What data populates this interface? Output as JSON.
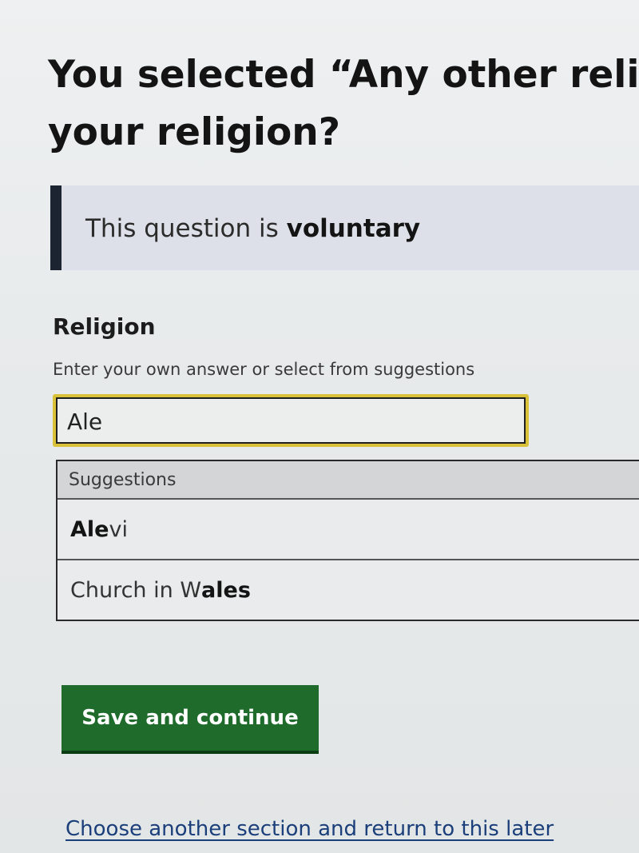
{
  "heading": {
    "line1": "You selected “Any other relig",
    "line2": "your religion?"
  },
  "notice": {
    "prefix": "This question is ",
    "emphasis": "voluntary"
  },
  "field": {
    "label": "Religion",
    "hint": "Enter your own answer or select from suggestions",
    "value": "Ale"
  },
  "suggestions": {
    "header": "Suggestions",
    "items": [
      {
        "match": "Ale",
        "rest": "vi",
        "pre": ""
      },
      {
        "pre": "Church in W",
        "match": "ales",
        "rest": ""
      }
    ]
  },
  "actions": {
    "save_label": "Save and continue",
    "later_link": "Choose another section and return to this later"
  },
  "colors": {
    "primary_button": "#1e6b2c",
    "focus_outline": "#d9c23a",
    "notice_border": "#1b2430",
    "link": "#1b3f7a"
  }
}
